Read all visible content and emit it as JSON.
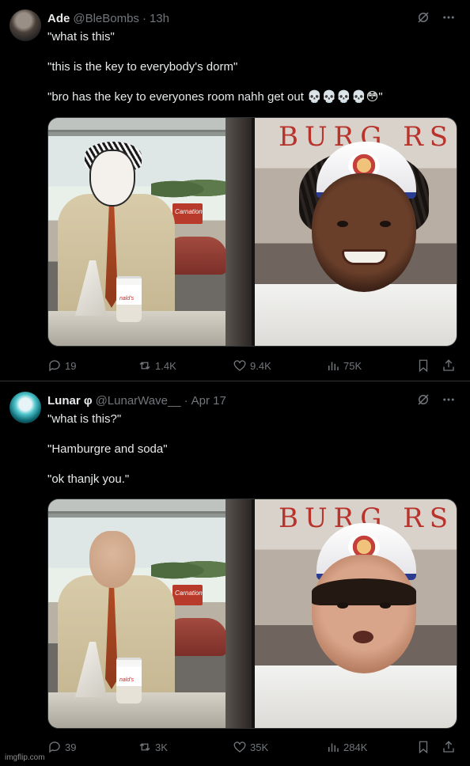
{
  "tweets": [
    {
      "author": {
        "name": "Ade",
        "handle": "@BleBombs",
        "time": "13h"
      },
      "text": [
        "\"what is this\"",
        "\"this is the key to everybody's dorm\"",
        "\"bro has the key to everyones room nahh get out 💀💀💀💀😳\""
      ],
      "media": {
        "left_sign": "Carnation",
        "cup_logo": "nald's",
        "right_sign": "BURG RS"
      },
      "stats": {
        "replies": "19",
        "reposts": "1.4K",
        "likes": "9.4K",
        "views": "75K"
      }
    },
    {
      "author": {
        "name": "Lunar φ",
        "handle": "@LunarWave__",
        "time": "Apr 17"
      },
      "text": [
        "\"what is this?\"",
        "\"Hamburgre and soda\"",
        "\"ok thanjk you.\""
      ],
      "media": {
        "left_sign": "Carnation",
        "cup_logo": "nald's",
        "right_sign": "BURG RS"
      },
      "stats": {
        "replies": "39",
        "reposts": "3K",
        "likes": "35K",
        "views": "284K"
      }
    }
  ],
  "watermark": "imgflip.com",
  "colors": {
    "background": "#000000",
    "text": "#e7e9ea",
    "muted": "#71767b",
    "divider": "#2f3336"
  },
  "icons": [
    "grok-icon",
    "more-icon",
    "reply-icon",
    "repost-icon",
    "like-icon",
    "views-icon",
    "bookmark-icon",
    "share-icon"
  ]
}
